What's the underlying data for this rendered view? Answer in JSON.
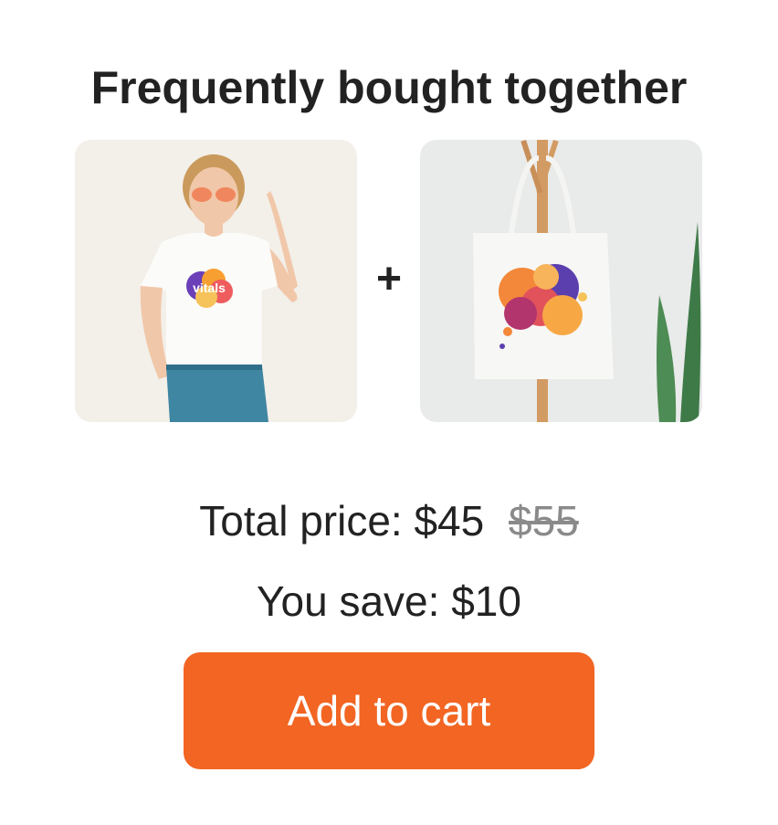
{
  "header": {
    "title": "Frequently bought together"
  },
  "products": [
    {
      "name": "t-shirt",
      "image_alt": "Woman wearing white t-shirt with colorful logo",
      "logo_text": "vitals"
    },
    {
      "name": "tote-bag",
      "image_alt": "White tote bag with colorful circles on a coat stand"
    }
  ],
  "bundle": {
    "separator": "+",
    "total_label": "Total price:",
    "total_price": "$45",
    "original_price": "$55",
    "save_label": "You save:",
    "save_amount": "$10"
  },
  "cta": {
    "label": "Add to cart",
    "color": "#f26522"
  },
  "colors": {
    "text": "#222222",
    "strikethrough": "#8a8a8a",
    "accent": "#f26522"
  }
}
